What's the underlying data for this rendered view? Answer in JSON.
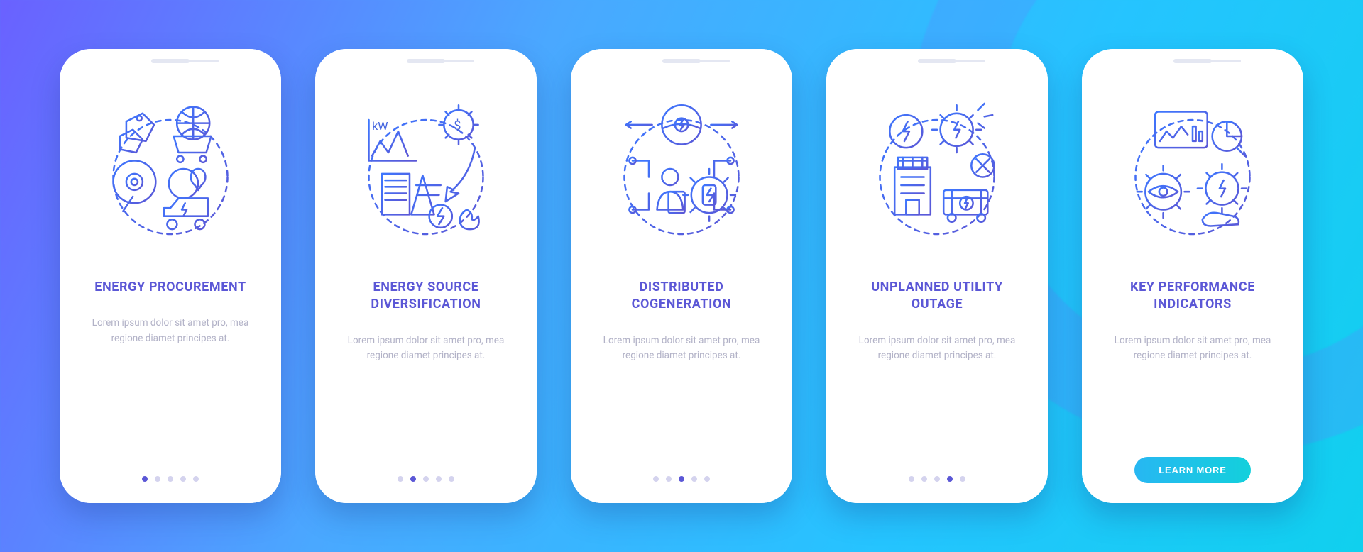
{
  "colors": {
    "stroke_start": "#3d77ff",
    "stroke_end": "#5b57d6",
    "title": "#5b57d6",
    "body": "#b2b2c7",
    "cta_start": "#27b7f2",
    "cta_end": "#13d0dc"
  },
  "screens": [
    {
      "icon": "energy-procurement-icon",
      "title": "ENERGY PROCUREMENT",
      "desc": "Lorem ipsum dolor sit amet pro, mea regione diamet principes at.",
      "active_dot": 0,
      "has_cta": false
    },
    {
      "icon": "energy-source-diversification-icon",
      "title": "ENERGY SOURCE DIVERSIFICATION",
      "desc": "Lorem ipsum dolor sit amet pro, mea regione diamet principes at.",
      "active_dot": 1,
      "has_cta": false
    },
    {
      "icon": "distributed-cogeneration-icon",
      "title": "DISTRIBUTED COGENERATION",
      "desc": "Lorem ipsum dolor sit amet pro, mea regione diamet principes at.",
      "active_dot": 2,
      "has_cta": false
    },
    {
      "icon": "unplanned-utility-outage-icon",
      "title": "UNPLANNED UTILITY OUTAGE",
      "desc": "Lorem ipsum dolor sit amet pro, mea regione diamet principes at.",
      "active_dot": 3,
      "has_cta": false
    },
    {
      "icon": "key-performance-indicators-icon",
      "title": "KEY PERFORMANCE INDICATORS",
      "desc": "Lorem ipsum dolor sit amet pro, mea regione diamet principes at.",
      "active_dot": 4,
      "has_cta": true,
      "cta_label": "LEARN MORE"
    }
  ],
  "dot_count": 5
}
